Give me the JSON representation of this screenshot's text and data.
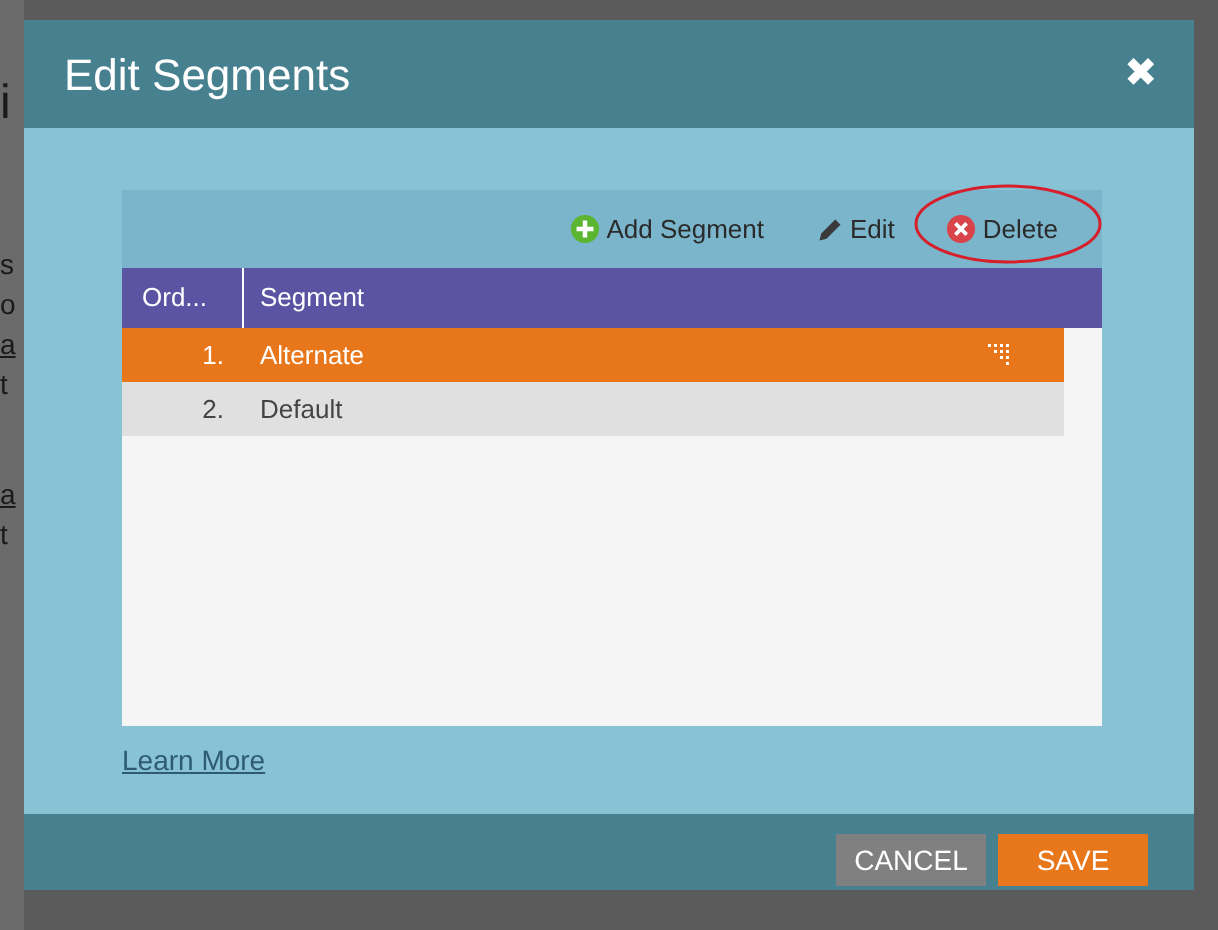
{
  "background_fragments": [
    {
      "text": "i",
      "kind": "heading"
    },
    {
      "text": "s",
      "kind": "text"
    },
    {
      "text": "o",
      "kind": "text"
    },
    {
      "text": "a",
      "kind": "link"
    },
    {
      "text": "t",
      "kind": "text"
    },
    {
      "text": "a",
      "kind": "link"
    },
    {
      "text": "t",
      "kind": "text"
    }
  ],
  "dialog": {
    "title": "Edit Segments",
    "close": "✖",
    "toolbar": [
      {
        "label": "Add Segment",
        "kind": "add",
        "circled": false
      },
      {
        "label": "Edit",
        "kind": "edit",
        "circled": false
      },
      {
        "label": "Delete",
        "kind": "delete",
        "circled": true
      }
    ],
    "table": {
      "columns": [
        "Ord...",
        "Segment"
      ],
      "rows": [
        {
          "order": "1.",
          "segment": "Alternate",
          "selected": true
        },
        {
          "order": "2.",
          "segment": "Default",
          "selected": false
        }
      ]
    },
    "link": "Learn More",
    "buttons": [
      {
        "label": "CANCEL",
        "kind": "secondary"
      },
      {
        "label": "SAVE",
        "kind": "primary"
      }
    ]
  }
}
